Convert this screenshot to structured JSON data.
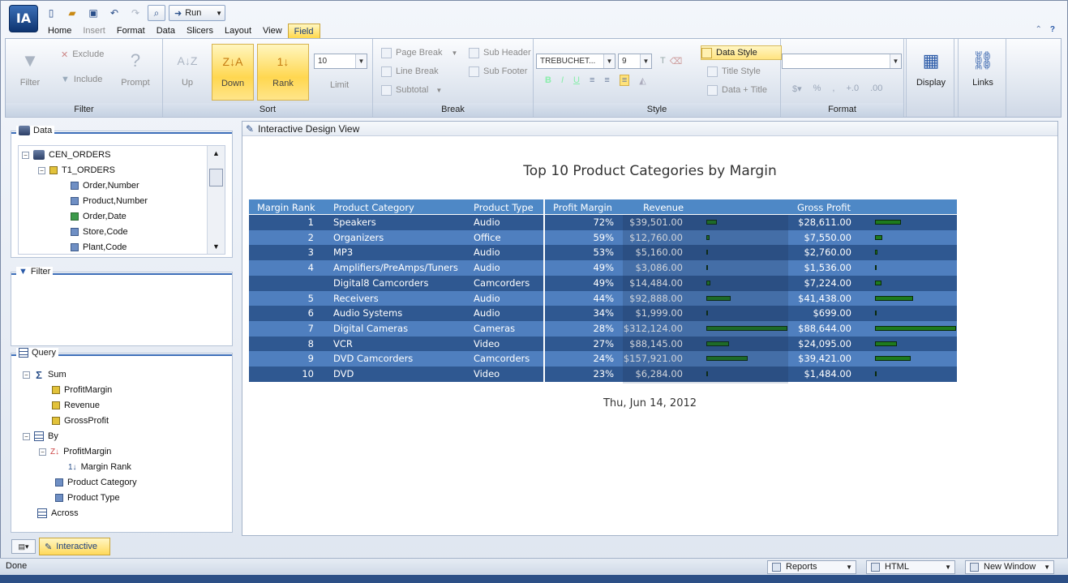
{
  "app": {
    "logo": "IA",
    "run_label": "Run",
    "status": "Done"
  },
  "menu": {
    "tabs": [
      "Home",
      "Insert",
      "Format",
      "Data",
      "Slicers",
      "Layout",
      "View",
      "Field"
    ],
    "active": "Field",
    "disabled": [
      "Insert"
    ]
  },
  "ribbon": {
    "filter": {
      "label": "Filter",
      "filter_btn": "Filter",
      "exclude": "Exclude",
      "include": "Include",
      "prompt": "Prompt"
    },
    "sort": {
      "label": "Sort",
      "up": "Up",
      "down": "Down",
      "rank": "Rank",
      "limit_value": "10",
      "limit": "Limit"
    },
    "break": {
      "label": "Break",
      "page_break": "Page Break",
      "line_break": "Line Break",
      "subtotal": "Subtotal",
      "sub_header": "Sub Header",
      "sub_footer": "Sub Footer"
    },
    "style": {
      "label": "Style",
      "font": "TREBUCHET...",
      "size": "9",
      "data_style": "Data Style",
      "title_style": "Title Style",
      "data_title": "Data + Title"
    },
    "format": {
      "label": "Format",
      "format_value": ""
    },
    "display": "Display",
    "links": "Links"
  },
  "panels": {
    "data": {
      "title": "Data",
      "items": [
        {
          "label": "CEN_ORDERS",
          "icon": "database-icon",
          "level": 0,
          "toggle": "⊟"
        },
        {
          "label": "T1_ORDERS",
          "icon": "table-icon",
          "level": 1,
          "toggle": "⊟"
        },
        {
          "label": "Order,Number",
          "icon": "field-icon",
          "level": 2
        },
        {
          "label": "Product,Number",
          "icon": "field-icon",
          "level": 2
        },
        {
          "label": "Order,Date",
          "icon": "date-field-icon",
          "level": 2
        },
        {
          "label": "Store,Code",
          "icon": "field-icon",
          "level": 2
        },
        {
          "label": "Plant,Code",
          "icon": "field-icon",
          "level": 2
        }
      ]
    },
    "filter": {
      "title": "Filter"
    },
    "query": {
      "title": "Query",
      "items": [
        {
          "label": "Sum",
          "level": 0,
          "toggle": "⊟",
          "icon": "sigma-icon"
        },
        {
          "label": "ProfitMargin",
          "level": 1,
          "icon": "measure-icon"
        },
        {
          "label": "Revenue",
          "level": 1,
          "icon": "measure-icon"
        },
        {
          "label": "GrossProfit",
          "level": 1,
          "icon": "measure-icon"
        },
        {
          "label": "By",
          "level": 0,
          "toggle": "⊟",
          "icon": "grid-icon"
        },
        {
          "label": "ProfitMargin",
          "level": 1,
          "toggle": "⊟",
          "icon": "sort-icon"
        },
        {
          "label": "Margin Rank",
          "level": 2,
          "icon": "rank-icon"
        },
        {
          "label": "Product Category",
          "level": 1,
          "icon": "field-icon"
        },
        {
          "label": "Product Type",
          "level": 1,
          "icon": "field-icon"
        },
        {
          "label": "Across",
          "level": 0,
          "icon": "grid-icon"
        }
      ]
    }
  },
  "bottom_tab": "Interactive",
  "view": {
    "header": "Interactive Design View",
    "report": {
      "title": "Top 10 Product Categories by Margin",
      "date": "Thu, Jun 14, 2012",
      "columns": [
        "Margin Rank",
        "Product Category",
        "Product Type",
        "Profit Margin",
        "Revenue",
        "Gross Profit"
      ],
      "rows": [
        {
          "rank": "1",
          "category": "Speakers",
          "type": "Audio",
          "margin": "72%",
          "revenue": "$39,501.00",
          "rev_value": 39501,
          "profit": "$28,611.00",
          "profit_value": 28611
        },
        {
          "rank": "2",
          "category": "Organizers",
          "type": "Office",
          "margin": "59%",
          "revenue": "$12,760.00",
          "rev_value": 12760,
          "profit": "$7,550.00",
          "profit_value": 7550
        },
        {
          "rank": "3",
          "category": "MP3",
          "type": "Audio",
          "margin": "53%",
          "revenue": "$5,160.00",
          "rev_value": 5160,
          "profit": "$2,760.00",
          "profit_value": 2760
        },
        {
          "rank": "4",
          "category": "Amplifiers/PreAmps/Tuners",
          "type": "Audio",
          "margin": "49%",
          "revenue": "$3,086.00",
          "rev_value": 3086,
          "profit": "$1,536.00",
          "profit_value": 1536
        },
        {
          "rank": "",
          "category": "Digital8 Camcorders",
          "type": "Camcorders",
          "margin": "49%",
          "revenue": "$14,484.00",
          "rev_value": 14484,
          "profit": "$7,224.00",
          "profit_value": 7224
        },
        {
          "rank": "5",
          "category": "Receivers",
          "type": "Audio",
          "margin": "44%",
          "revenue": "$92,888.00",
          "rev_value": 92888,
          "profit": "$41,438.00",
          "profit_value": 41438
        },
        {
          "rank": "6",
          "category": "Audio Systems",
          "type": "Audio",
          "margin": "34%",
          "revenue": "$1,999.00",
          "rev_value": 1999,
          "profit": "$699.00",
          "profit_value": 699
        },
        {
          "rank": "7",
          "category": "Digital Cameras",
          "type": "Cameras",
          "margin": "28%",
          "revenue": "$312,124.00",
          "rev_value": 312124,
          "profit": "$88,644.00",
          "profit_value": 88644
        },
        {
          "rank": "8",
          "category": "VCR",
          "type": "Video",
          "margin": "27%",
          "revenue": "$88,145.00",
          "rev_value": 88145,
          "profit": "$24,095.00",
          "profit_value": 24095
        },
        {
          "rank": "9",
          "category": "DVD Camcorders",
          "type": "Camcorders",
          "margin": "24%",
          "revenue": "$157,921.00",
          "rev_value": 157921,
          "profit": "$39,421.00",
          "profit_value": 39421
        },
        {
          "rank": "10",
          "category": "DVD",
          "type": "Video",
          "margin": "23%",
          "revenue": "$6,284.00",
          "rev_value": 6284,
          "profit": "$1,484.00",
          "profit_value": 1484
        }
      ]
    }
  },
  "statusbar": {
    "reports": "Reports",
    "html": "HTML",
    "window": "New Window"
  },
  "colors": {
    "header_blue": "#4e88c6",
    "row_dark": "#2f5891",
    "row_light": "#4f7fbf",
    "bar_green": "#1e7a1e",
    "active_tab": "#ffd84a"
  }
}
